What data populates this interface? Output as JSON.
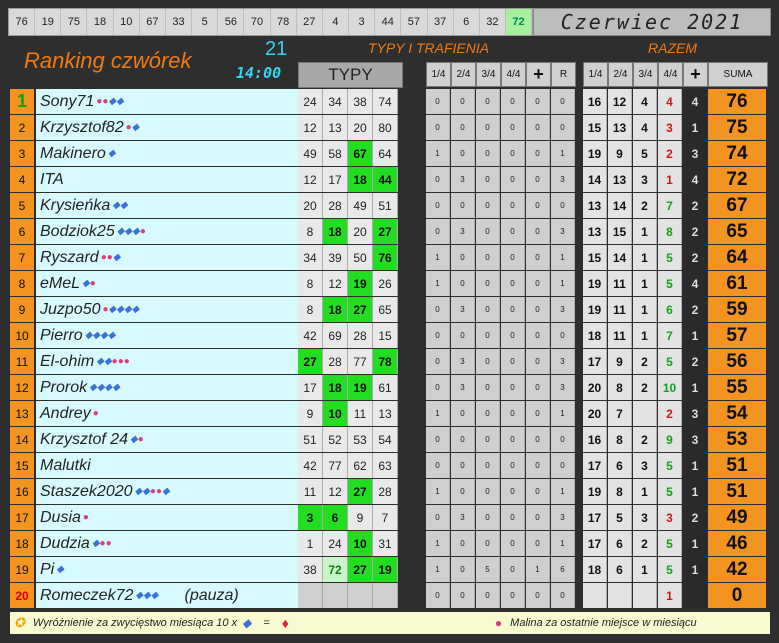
{
  "top_numbers": [
    "76",
    "19",
    "75",
    "18",
    "10",
    "67",
    "33",
    "5",
    "56",
    "70",
    "78",
    "27",
    "4",
    "3",
    "44",
    "57",
    "37",
    "6",
    "32",
    "72"
  ],
  "top_highlight_index": 19,
  "month_title": "Czerwiec 2021",
  "ranking_title": "Ranking czwórek",
  "round": {
    "number": "21",
    "time": "14:00"
  },
  "labels": {
    "typy_trafienia": "TYPY I TRAFIENIA",
    "razem": "RAZEM",
    "typy": "TYPY"
  },
  "hit_headers": [
    "1/4",
    "2/4",
    "3/4",
    "4/4",
    "+",
    "R"
  ],
  "razem_headers": [
    "1/4",
    "2/4",
    "3/4",
    "4/4",
    "+",
    "SUMA"
  ],
  "colors": {
    "orange": "#f39320",
    "cyan_name": "#d6fafe",
    "green_hit": "#22dd22",
    "title_orange": "#f07a10",
    "round_cyan": "#37d3f0"
  },
  "players": [
    {
      "rank": "1",
      "name": "Sony71",
      "icons": "rrdd",
      "tips": [
        "24",
        "34",
        "38",
        "74"
      ],
      "tipstyle": [
        "",
        "",
        "",
        ""
      ],
      "hits": [
        "0",
        "0",
        "0",
        "0",
        "0",
        "0"
      ],
      "razem": [
        "16",
        "12",
        "4",
        "4",
        "4"
      ],
      "sum4style": "red",
      "suma": "76"
    },
    {
      "rank": "2",
      "name": "Krzysztof82",
      "icons": "rd",
      "tips": [
        "12",
        "13",
        "20",
        "80"
      ],
      "tipstyle": [
        "",
        "",
        "",
        ""
      ],
      "hits": [
        "0",
        "0",
        "0",
        "0",
        "0",
        "0"
      ],
      "razem": [
        "15",
        "13",
        "4",
        "3",
        "1"
      ],
      "sum4style": "red",
      "suma": "75"
    },
    {
      "rank": "3",
      "name": "Makinero",
      "icons": "d",
      "tips": [
        "49",
        "58",
        "67",
        "64"
      ],
      "tipstyle": [
        "",
        "",
        "g",
        ""
      ],
      "hits": [
        "1",
        "0",
        "0",
        "0",
        "0",
        "1"
      ],
      "razem": [
        "19",
        "9",
        "5",
        "2",
        "3"
      ],
      "sum4style": "red",
      "suma": "74"
    },
    {
      "rank": "4",
      "name": "ITA",
      "icons": "",
      "tips": [
        "12",
        "17",
        "18",
        "44"
      ],
      "tipstyle": [
        "",
        "",
        "g",
        "g"
      ],
      "hits": [
        "0",
        "3",
        "0",
        "0",
        "0",
        "3"
      ],
      "razem": [
        "14",
        "13",
        "3",
        "1",
        "4"
      ],
      "sum4style": "red",
      "suma": "72"
    },
    {
      "rank": "5",
      "name": "Krysieńka",
      "icons": "dd",
      "tips": [
        "20",
        "28",
        "49",
        "51"
      ],
      "tipstyle": [
        "",
        "",
        "",
        ""
      ],
      "hits": [
        "0",
        "0",
        "0",
        "0",
        "0",
        "0"
      ],
      "razem": [
        "13",
        "14",
        "2",
        "7",
        "2"
      ],
      "sum4style": "green",
      "suma": "67"
    },
    {
      "rank": "6",
      "name": "Bodziok25",
      "icons": "dddr",
      "tips": [
        "8",
        "18",
        "20",
        "27"
      ],
      "tipstyle": [
        "",
        "g",
        "",
        "g"
      ],
      "hits": [
        "0",
        "3",
        "0",
        "0",
        "0",
        "3"
      ],
      "razem": [
        "13",
        "15",
        "1",
        "8",
        "2"
      ],
      "sum4style": "green",
      "suma": "65"
    },
    {
      "rank": "7",
      "name": "Ryszard",
      "icons": "rrd",
      "tips": [
        "34",
        "39",
        "50",
        "76"
      ],
      "tipstyle": [
        "",
        "",
        "",
        "g"
      ],
      "hits": [
        "1",
        "0",
        "0",
        "0",
        "0",
        "1"
      ],
      "razem": [
        "15",
        "14",
        "1",
        "5",
        "2"
      ],
      "sum4style": "green",
      "suma": "64"
    },
    {
      "rank": "8",
      "name": "eMeL",
      "icons": "dr",
      "tips": [
        "8",
        "12",
        "19",
        "26"
      ],
      "tipstyle": [
        "",
        "",
        "g",
        ""
      ],
      "hits": [
        "1",
        "0",
        "0",
        "0",
        "0",
        "1"
      ],
      "razem": [
        "19",
        "11",
        "1",
        "5",
        "4"
      ],
      "sum4style": "green",
      "suma": "61"
    },
    {
      "rank": "9",
      "name": "Juzpo50",
      "icons": "rdddd",
      "tips": [
        "8",
        "18",
        "27",
        "65"
      ],
      "tipstyle": [
        "",
        "g",
        "g",
        ""
      ],
      "hits": [
        "0",
        "3",
        "0",
        "0",
        "0",
        "3"
      ],
      "razem": [
        "19",
        "11",
        "1",
        "6",
        "2"
      ],
      "sum4style": "green",
      "suma": "59"
    },
    {
      "rank": "10",
      "name": "Pierro",
      "icons": "dddd",
      "tips": [
        "42",
        "69",
        "28",
        "15"
      ],
      "tipstyle": [
        "",
        "",
        "",
        ""
      ],
      "hits": [
        "0",
        "0",
        "0",
        "0",
        "0",
        "0"
      ],
      "razem": [
        "18",
        "11",
        "1",
        "7",
        "1"
      ],
      "sum4style": "green",
      "suma": "57"
    },
    {
      "rank": "11",
      "name": "El-ohim",
      "icons": "ddrrr",
      "tips": [
        "27",
        "28",
        "77",
        "78"
      ],
      "tipstyle": [
        "g",
        "",
        "",
        "g"
      ],
      "hits": [
        "0",
        "3",
        "0",
        "0",
        "0",
        "3"
      ],
      "razem": [
        "17",
        "9",
        "2",
        "5",
        "2"
      ],
      "sum4style": "green",
      "suma": "56"
    },
    {
      "rank": "12",
      "name": "Prorok",
      "icons": "dddd",
      "tips": [
        "17",
        "18",
        "19",
        "61"
      ],
      "tipstyle": [
        "",
        "g",
        "g",
        ""
      ],
      "hits": [
        "0",
        "3",
        "0",
        "0",
        "0",
        "3"
      ],
      "razem": [
        "20",
        "8",
        "2",
        "10",
        "1"
      ],
      "sum4style": "green",
      "suma": "55"
    },
    {
      "rank": "13",
      "name": "Andrey",
      "icons": "r",
      "tips": [
        "9",
        "10",
        "11",
        "13"
      ],
      "tipstyle": [
        "",
        "g",
        "",
        ""
      ],
      "hits": [
        "1",
        "0",
        "0",
        "0",
        "0",
        "1"
      ],
      "razem": [
        "20",
        "7",
        "",
        "2",
        "3"
      ],
      "sum4style": "red",
      "suma": "54"
    },
    {
      "rank": "14",
      "name": "Krzysztof 24",
      "icons": "dr",
      "tips": [
        "51",
        "52",
        "53",
        "54"
      ],
      "tipstyle": [
        "",
        "",
        "",
        ""
      ],
      "hits": [
        "0",
        "0",
        "0",
        "0",
        "0",
        "0"
      ],
      "razem": [
        "16",
        "8",
        "2",
        "9",
        "3"
      ],
      "sum4style": "green",
      "suma": "53"
    },
    {
      "rank": "15",
      "name": "Malutki",
      "icons": "",
      "tips": [
        "42",
        "77",
        "62",
        "63"
      ],
      "tipstyle": [
        "",
        "",
        "",
        ""
      ],
      "hits": [
        "0",
        "0",
        "0",
        "0",
        "0",
        "0"
      ],
      "razem": [
        "17",
        "6",
        "3",
        "5",
        "1"
      ],
      "sum4style": "green",
      "suma": "51"
    },
    {
      "rank": "16",
      "name": "Staszek2020",
      "icons": "ddrrd",
      "tips": [
        "11",
        "12",
        "27",
        "28"
      ],
      "tipstyle": [
        "",
        "",
        "g",
        ""
      ],
      "hits": [
        "1",
        "0",
        "0",
        "0",
        "0",
        "1"
      ],
      "razem": [
        "19",
        "8",
        "1",
        "5",
        "1"
      ],
      "sum4style": "green",
      "suma": "51"
    },
    {
      "rank": "17",
      "name": "Dusia",
      "icons": "r",
      "tips": [
        "3",
        "6",
        "9",
        "7"
      ],
      "tipstyle": [
        "g",
        "g",
        "",
        ""
      ],
      "hits": [
        "0",
        "3",
        "0",
        "0",
        "0",
        "3"
      ],
      "razem": [
        "17",
        "5",
        "3",
        "3",
        "2"
      ],
      "sum4style": "red",
      "suma": "49"
    },
    {
      "rank": "18",
      "name": "Dudzia",
      "icons": "drr",
      "tips": [
        "1",
        "24",
        "10",
        "31"
      ],
      "tipstyle": [
        "",
        "",
        "g",
        ""
      ],
      "hits": [
        "1",
        "0",
        "0",
        "0",
        "0",
        "1"
      ],
      "razem": [
        "17",
        "6",
        "2",
        "5",
        "1"
      ],
      "sum4style": "green",
      "suma": "46"
    },
    {
      "rank": "19",
      "name": "Pi",
      "icons": "d",
      "tips": [
        "38",
        "72",
        "27",
        "19"
      ],
      "tipstyle": [
        "",
        "lg",
        "g",
        "g"
      ],
      "hits": [
        "1",
        "0",
        "5",
        "0",
        "1",
        "6"
      ],
      "razem": [
        "18",
        "6",
        "1",
        "5",
        "1"
      ],
      "sum4style": "green",
      "suma": "42"
    },
    {
      "rank": "20",
      "name": "Romeczek72",
      "icons": "ddd",
      "note": "(pauza)",
      "tips": [
        "",
        "",
        "",
        ""
      ],
      "tipstyle": [
        "empty",
        "empty",
        "empty",
        "empty"
      ],
      "hits": [
        "0",
        "0",
        "0",
        "0",
        "0",
        "0"
      ],
      "razem": [
        "",
        "",
        "",
        "1",
        ""
      ],
      "sum4style": "red",
      "suma": "0"
    }
  ],
  "footer": {
    "left": "Wyróżnienie za zwycięstwo miesiąca 10 x",
    "equals": "=",
    "right": "Malina za ostatnie miejsce w miesiącu"
  }
}
